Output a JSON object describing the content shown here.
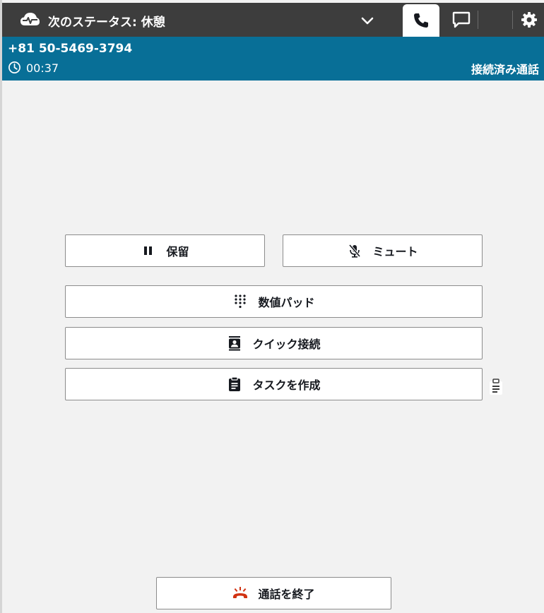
{
  "header": {
    "status_text": "次のステータス: 休憩",
    "cloud_icon": "cloud-heartbeat-icon",
    "tabs": [
      {
        "name": "phone",
        "icon": "phone-icon",
        "active": true
      },
      {
        "name": "chat",
        "icon": "chat-icon",
        "active": false
      },
      {
        "name": "tasks",
        "icon": "clipboard-icon",
        "active": false
      },
      {
        "name": "settings",
        "icon": "gear-icon",
        "active": false
      }
    ]
  },
  "call": {
    "number": "+81 50-5469-3794",
    "timer": "00:37",
    "state": "接続済み通話"
  },
  "controls": {
    "hold_label": "保留",
    "mute_label": "ミュート",
    "keypad_label": "数値パッド",
    "quick_connect_label": "クイック接続",
    "create_task_label": "タスクを作成",
    "end_call_label": "通話を終了"
  },
  "colors": {
    "topbar": "#3d3d3d",
    "callbar": "#086f97",
    "background": "#f2f2f2",
    "end_call_icon": "#d13212"
  }
}
